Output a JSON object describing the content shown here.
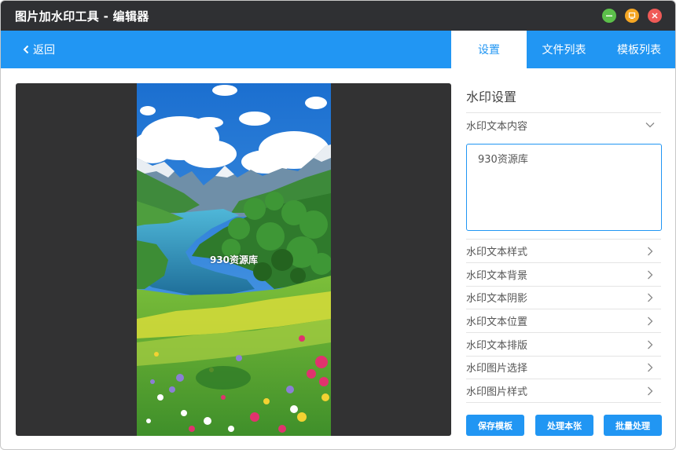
{
  "window": {
    "title": "图片加水印工具 - 编辑器"
  },
  "navbar": {
    "back_label": "返回",
    "tabs": [
      {
        "label": "设置",
        "active": true
      },
      {
        "label": "文件列表",
        "active": false
      },
      {
        "label": "模板列表",
        "active": false
      }
    ]
  },
  "preview": {
    "watermark_text": "930资源库"
  },
  "panel": {
    "title": "水印设置",
    "text_section": {
      "label": "水印文本内容",
      "icon": "chevron-down-icon",
      "value": "930资源库"
    },
    "options": [
      {
        "label": "水印文本样式",
        "icon": "chevron-right-icon"
      },
      {
        "label": "水印文本背景",
        "icon": "chevron-right-icon"
      },
      {
        "label": "水印文本阴影",
        "icon": "chevron-right-icon"
      },
      {
        "label": "水印文本位置",
        "icon": "chevron-right-icon"
      },
      {
        "label": "水印文本排版",
        "icon": "chevron-right-icon"
      },
      {
        "label": "水印图片选择",
        "icon": "chevron-right-icon"
      },
      {
        "label": "水印图片样式",
        "icon": "chevron-right-icon"
      }
    ],
    "actions": {
      "save_template": "保存模板",
      "process_current": "处理本张",
      "batch_process": "批量处理"
    }
  },
  "colors": {
    "accent": "#2196f3",
    "titlebar": "#2f3033",
    "preview_bg": "#323233",
    "minimize": "#5cc04a",
    "maximize": "#f5a623",
    "close": "#ef5a57"
  }
}
